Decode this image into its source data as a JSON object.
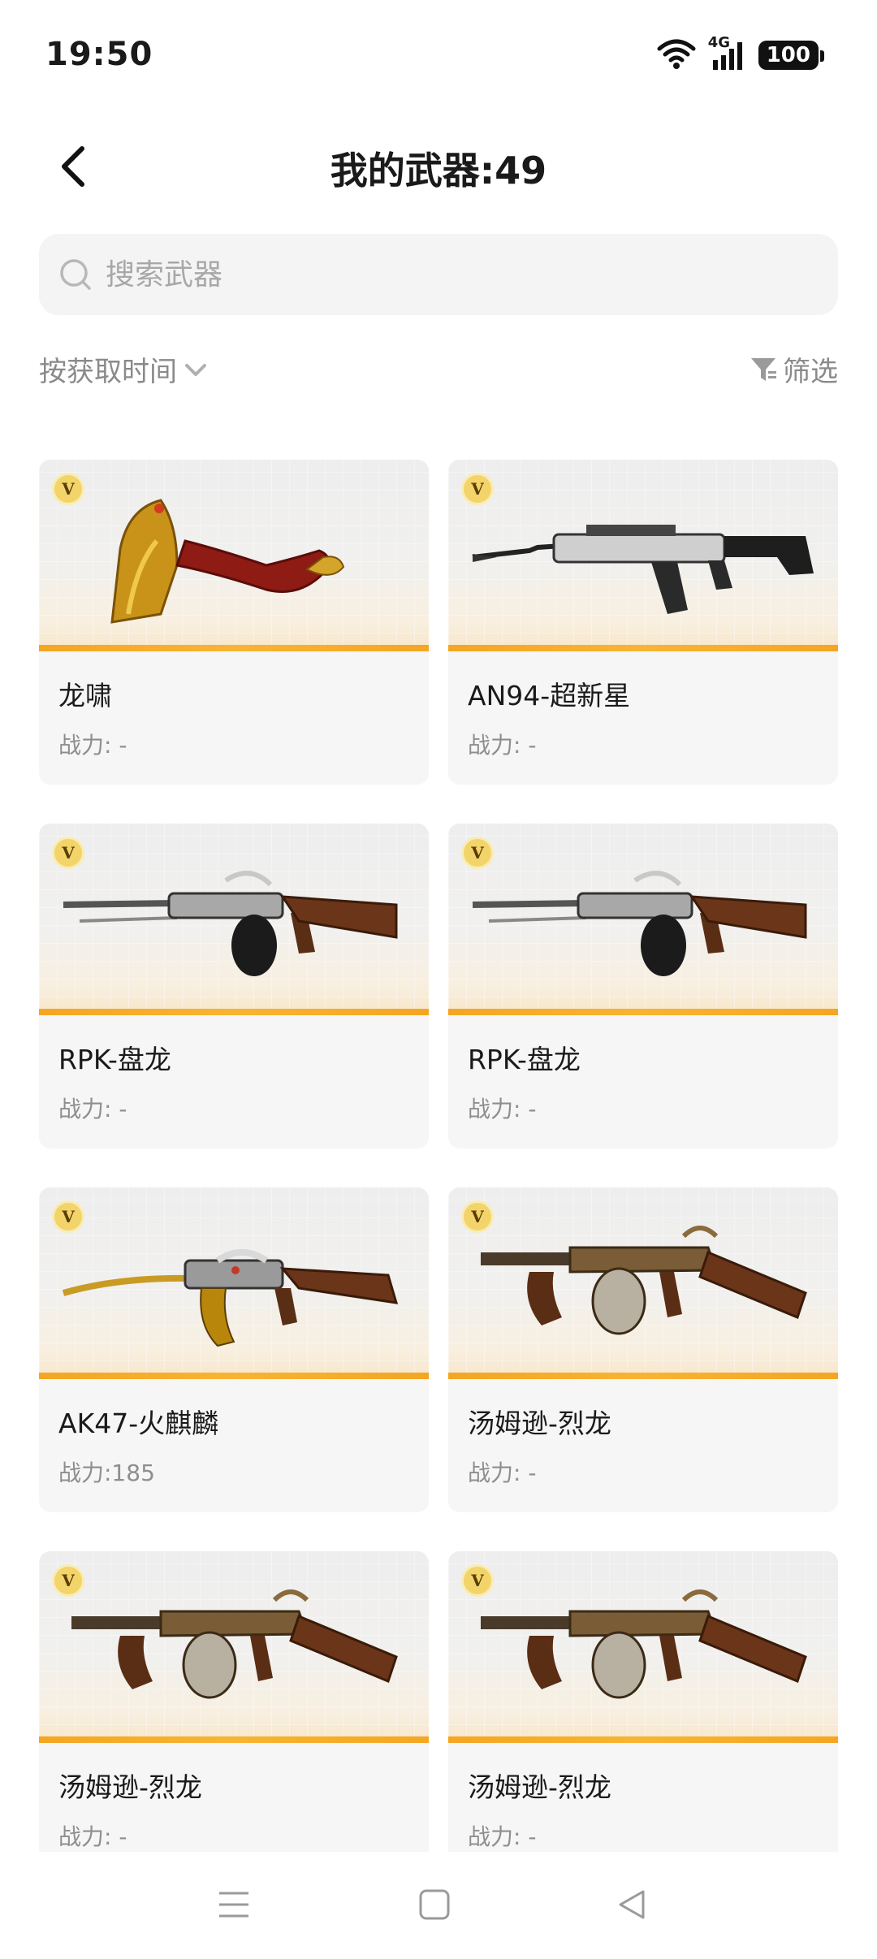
{
  "status_bar": {
    "time": "19:50",
    "network": "4G",
    "battery": "100",
    "icons": [
      "wifi-icon",
      "signal-icon",
      "battery-icon"
    ]
  },
  "header": {
    "title": "我的武器:49",
    "back_icon": "chevron-left-icon"
  },
  "search": {
    "placeholder": "搜索武器",
    "value": "",
    "icon": "search-icon"
  },
  "toolbar": {
    "sort_label": "按获取时间",
    "sort_icon": "chevron-down-icon",
    "filter_label": "筛选",
    "filter_icon": "filter-icon"
  },
  "weapons": [
    {
      "name": "龙啸",
      "power": "战力: -",
      "badge": "V",
      "art": "golden-axe"
    },
    {
      "name": "AN94-超新星",
      "power": "战力: -",
      "badge": "V",
      "art": "rifle-silver"
    },
    {
      "name": "RPK-盘龙",
      "power": "战力: -",
      "badge": "V",
      "art": "rpk"
    },
    {
      "name": "RPK-盘龙",
      "power": "战力: -",
      "badge": "V",
      "art": "rpk"
    },
    {
      "name": "AK47-火麒麟",
      "power": "战力:185",
      "badge": "V",
      "art": "ak47"
    },
    {
      "name": "汤姆逊-烈龙",
      "power": "战力: -",
      "badge": "V",
      "art": "thompson"
    },
    {
      "name": "汤姆逊-烈龙",
      "power": "战力: -",
      "badge": "V",
      "art": "thompson"
    },
    {
      "name": "汤姆逊-烈龙",
      "power": "战力: -",
      "badge": "V",
      "art": "thompson"
    }
  ],
  "colors": {
    "accent_bar": "#f4a623",
    "card_bg": "#f6f6f6",
    "muted_text": "#8e8e8e"
  },
  "nav": {
    "items": [
      "menu-icon",
      "home-icon",
      "back-icon"
    ]
  }
}
